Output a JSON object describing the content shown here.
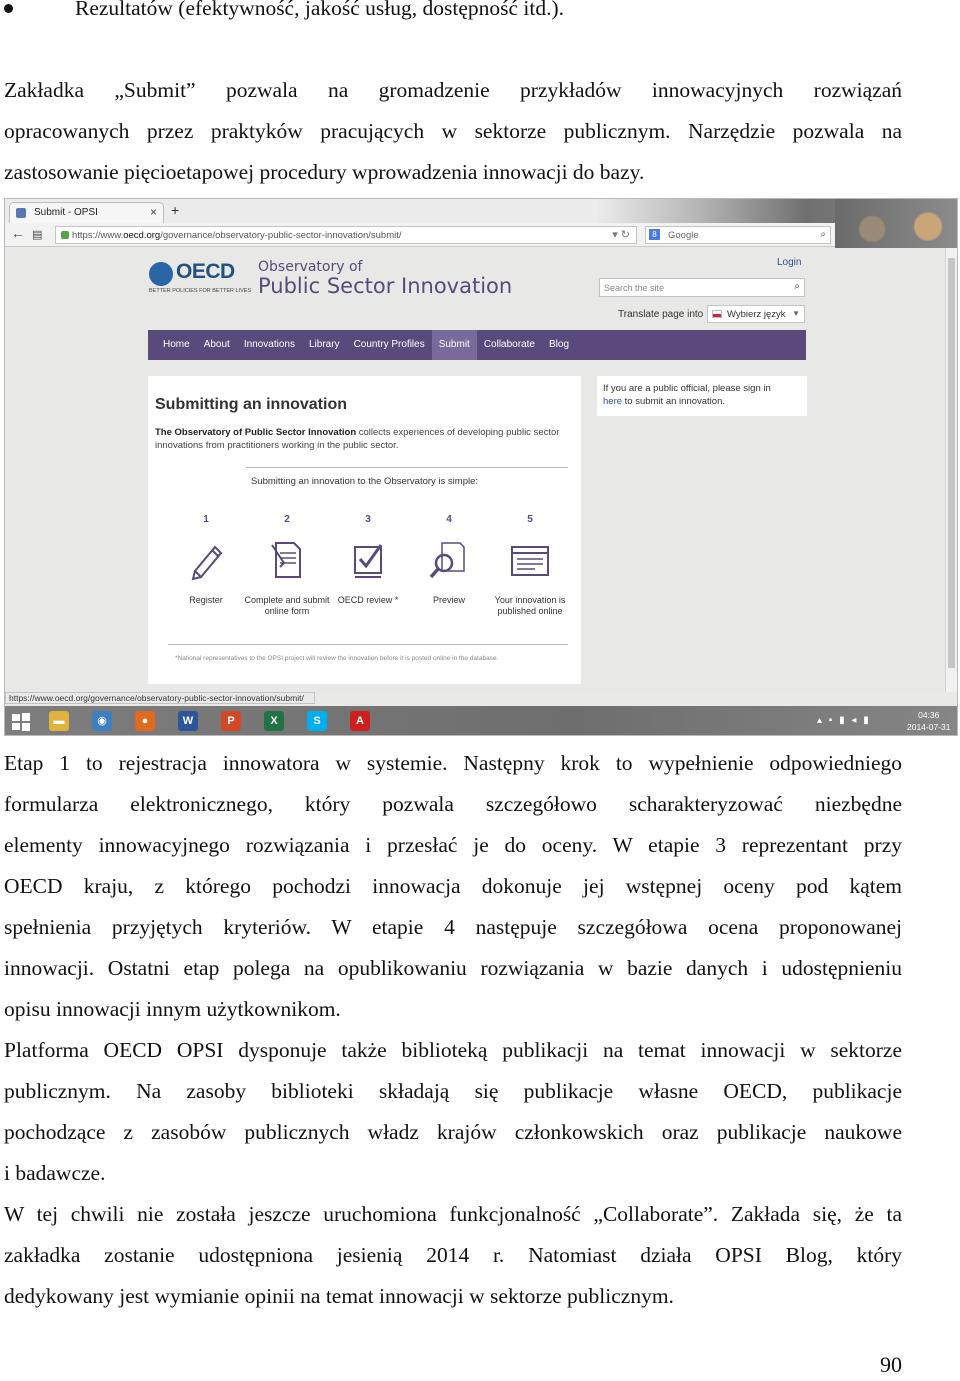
{
  "bullet": {
    "text": "Rezultatów (efektywność, jakość usług, dostępność itd.)."
  },
  "intro": {
    "lines": [
      "Zakładka „Submit” pozwala na gromadzenie przykładów innowacyjnych rozwiązań",
      "opracowanych przez praktyków pracujących w sektorze publicznym. Narzędzie pozwala na",
      "zastosowanie pięcioetapowej procedury wprowadzenia innowacji do bazy."
    ]
  },
  "screenshot": {
    "tab_title": "Submit - OPSI",
    "tab_close": "×",
    "new_tab": "+",
    "window_controls": [
      "–",
      "❐",
      "✕"
    ],
    "nav_buttons": [
      "←",
      "▤"
    ],
    "url_prefix": "https://www.",
    "url_domain": "oecd.org",
    "url_path": "/governance/observatory-public-sector-innovation/submit/",
    "url_tools": "▾ ↻",
    "google_g": "8",
    "google_label": "Google",
    "google_search_icon": "⌕",
    "oecd_logo_text": "OECD",
    "oecd_tagline": "BETTER POLICIES FOR BETTER LIVES",
    "obs_line1": "Observatory of",
    "obs_line2": "Public Sector Innovation",
    "login": "Login",
    "search_placeholder": "Search the site",
    "search_icon": "⌕",
    "translate_label": "Translate page into",
    "lang_selected": "Wybierz język",
    "lang_arrow": "▼",
    "nav": [
      "Home",
      "About",
      "Innovations",
      "Library",
      "Country Profiles",
      "Submit",
      "Collaborate",
      "Blog"
    ],
    "card_title": "Submitting an innovation",
    "card_intro_bold": "The Observatory of Public Sector Innovation",
    "card_intro_rest": " collects experiences of developing public sector innovations from practitioners working in the public sector.",
    "card_subtitle": "Submitting an innovation to the Observatory is simple:",
    "steps": [
      {
        "num": "1",
        "label": "Register",
        "icon": "pencil-icon"
      },
      {
        "num": "2",
        "label": "Complete and submit online form",
        "icon": "document-icon"
      },
      {
        "num": "3",
        "label": "OECD review *",
        "icon": "checklist-icon"
      },
      {
        "num": "4",
        "label": "Preview",
        "icon": "magnifier-icon"
      },
      {
        "num": "5",
        "label": "Your innovation is published online",
        "icon": "webpage-icon"
      }
    ],
    "card_note": "*National representatives to the OPSI project will review the innovation before it is posted online in the database.",
    "sign_text_1": "If you are a public official, please sign in",
    "sign_link": "here",
    "sign_text_2": " to submit an innovation.",
    "status_url": "https://www.oecd.org/governance/observatory-public-sector-innovation/submit/",
    "taskbar_apps": [
      {
        "icon": "file-explorer-icon",
        "glyph": "▬",
        "color": "#e0b43c"
      },
      {
        "icon": "network-icon",
        "glyph": "◉",
        "color": "#3f7fbf"
      },
      {
        "icon": "firefox-icon",
        "glyph": "●",
        "color": "#e06a1f"
      },
      {
        "icon": "word-icon",
        "glyph": "W",
        "color": "#2b579a"
      },
      {
        "icon": "powerpoint-icon",
        "glyph": "P",
        "color": "#d24726"
      },
      {
        "icon": "excel-icon",
        "glyph": "X",
        "color": "#217346"
      },
      {
        "icon": "skype-icon",
        "glyph": "S",
        "color": "#00aff0"
      },
      {
        "icon": "acrobat-icon",
        "glyph": "A",
        "color": "#d01f1f"
      }
    ],
    "tray_icons": "▴ ▪ ▮ ◂ ▮",
    "tray_time": "04:36",
    "tray_date": "2014-07-31"
  },
  "body": {
    "p1": [
      "Etap 1 to rejestracja innowatora w systemie. Następny krok to wypełnienie odpowiedniego",
      "formularza elektronicznego, który pozwala szczegółowo scharakteryzować niezbędne",
      "elementy innowacyjnego rozwiązania i przesłać je do oceny. W etapie 3 reprezentant przy",
      "OECD kraju, z którego pochodzi innowacja dokonuje jej wstępnej oceny pod kątem",
      "spełnienia przyjętych kryteriów. W etapie 4 następuje szczegółowa ocena proponowanej",
      "innowacji. Ostatni etap polega na opublikowaniu rozwiązania w bazie danych i udostępnieniu",
      "opisu innowacji innym użytkownikom."
    ],
    "p2": [
      "Platforma OECD OPSI dysponuje także biblioteką publikacji na temat innowacji w sektorze",
      "publicznym. Na zasoby biblioteki składają się publikacje własne OECD, publikacje",
      "pochodzące z zasobów publicznych władz krajów członkowskich oraz publikacje naukowe",
      "i badawcze."
    ],
    "p3": [
      "W tej chwili nie została jeszcze uruchomiona funkcjonalność „Collaborate”. Zakłada się, że ta",
      "zakładka zostanie udostępniona jesienią 2014 r. Natomiast działa OPSI Blog, który",
      "dedykowany jest wymianie opinii na temat innowacji w sektorze publicznym."
    ]
  },
  "page_number": "90"
}
